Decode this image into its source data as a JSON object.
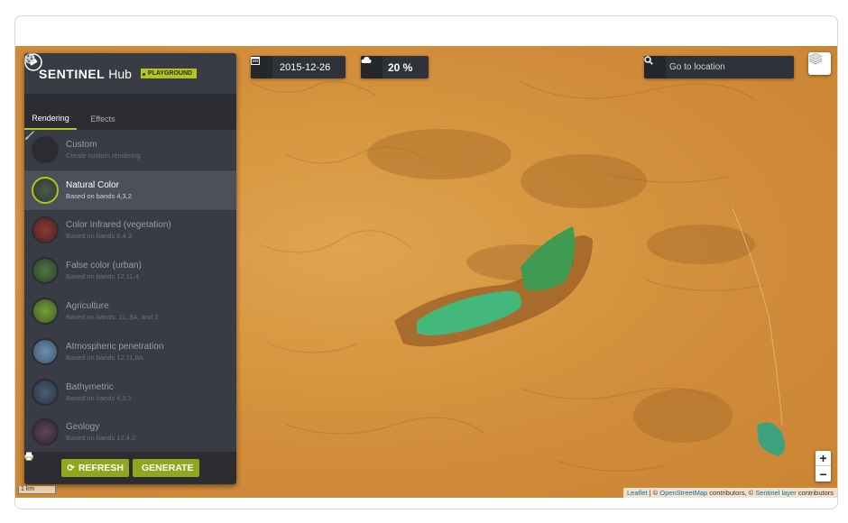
{
  "app": {
    "brand": "SENTINEL",
    "brand_suffix": "Hub",
    "badge": "PLAYGROUND"
  },
  "toolbar": {
    "date": "2015-12-26",
    "cloud_coverage": "20 %",
    "search_placeholder": "Go to location"
  },
  "tabs": [
    {
      "label": "Rendering",
      "icon": "palette-icon",
      "active": true
    },
    {
      "label": "Effects",
      "icon": "sliders-icon",
      "active": false
    }
  ],
  "renderings": [
    {
      "title": "Custom",
      "subtitle": "Create custom rendering",
      "thumb": "#2a2c32",
      "selected": false
    },
    {
      "title": "Natural Color",
      "subtitle": "Based on bands 4,3,2",
      "thumb": "#3c4a3f",
      "selected": true
    },
    {
      "title": "Color Infrared (vegetation)",
      "subtitle": "Based on bands 8,4,3",
      "thumb": "#6a2c2a",
      "selected": false
    },
    {
      "title": "False color (urban)",
      "subtitle": "Based on bands 12,11,4",
      "thumb": "#3e5e37",
      "selected": false
    },
    {
      "title": "Agriculture",
      "subtitle": "Based on bands: 11, 8A, and 2",
      "thumb": "#5a7d2e",
      "selected": false
    },
    {
      "title": "Atmospheric penetration",
      "subtitle": "Based on bands 12,11,8A",
      "thumb": "#4a6a86",
      "selected": false
    },
    {
      "title": "Bathymetric",
      "subtitle": "Based on bands 4,3,1",
      "thumb": "#3b4a5e",
      "selected": false
    },
    {
      "title": "Geology",
      "subtitle": "Based on bands 12,4,2",
      "thumb": "#4a3a48",
      "selected": false
    }
  ],
  "footer": {
    "refresh_label": "REFRESH",
    "generate_label": "GENERATE"
  },
  "map": {
    "zoom_in": "+",
    "zoom_out": "−",
    "scale": "1 km",
    "attribution_leaflet": "Leaflet",
    "attribution_sep1": " | © ",
    "attribution_osm": "OpenStreetMap",
    "attribution_mid": " contributors, © ",
    "attribution_sentinel": "Sentinel layer",
    "attribution_end": " contributors"
  },
  "colors": {
    "accent": "#b5c418",
    "button": "#8ea71d",
    "panel": "#393c44",
    "panel_dark": "#2b2d33"
  }
}
